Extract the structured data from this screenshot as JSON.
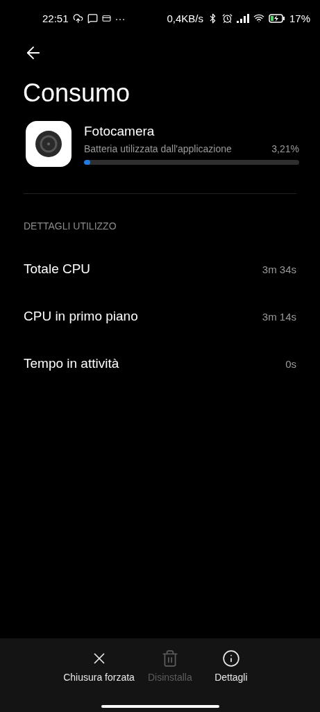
{
  "status_bar": {
    "time": "22:51",
    "dots": "···",
    "net_speed": "0,4KB/s",
    "battery_percent": "17%"
  },
  "title": "Consumo",
  "app": {
    "name": "Fotocamera",
    "subtitle": "Batteria utilizzata dall'applicazione",
    "percent": "3,21%",
    "level": 0.03
  },
  "section": "DETTAGLI UTILIZZO",
  "rows": [
    {
      "label": "Totale CPU",
      "value": "3m 34s"
    },
    {
      "label": "CPU in primo piano",
      "value": "3m 14s"
    },
    {
      "label": "Tempo in attività",
      "value": "0s"
    }
  ],
  "actions": [
    {
      "kind": "close",
      "label": "Chiusura forzata",
      "disabled": false
    },
    {
      "kind": "delete",
      "label": "Disinstalla",
      "disabled": true
    },
    {
      "kind": "info",
      "label": "Dettagli",
      "disabled": false
    }
  ]
}
